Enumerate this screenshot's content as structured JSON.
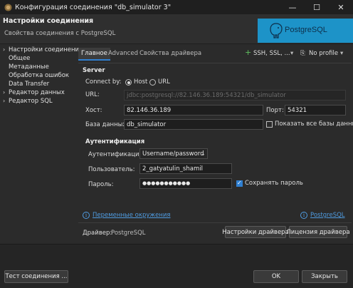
{
  "window": {
    "title": "Конфигурация соединения \"db_simulator 3\"",
    "minimize": "—",
    "maximize": "☐",
    "close": "✕"
  },
  "header": {
    "title": "Настройки соединения",
    "subtitle": "Свойства соединения с PostgreSQL",
    "logo_text": "PostgreSQL"
  },
  "sidebar": {
    "items": [
      {
        "label": "Настройки соединения",
        "expandable": true
      },
      {
        "label": "Общее",
        "expandable": false
      },
      {
        "label": "Метаданные",
        "expandable": false
      },
      {
        "label": "Обработка ошибок",
        "expandable": false
      },
      {
        "label": "Data Transfer",
        "expandable": false
      },
      {
        "label": "Редактор данных",
        "expandable": true
      },
      {
        "label": "Редактор SQL",
        "expandable": true
      }
    ]
  },
  "tabs": {
    "main": "Главное",
    "advanced": "Advanced",
    "driver_props": "Свойства драйвера",
    "ssh": "SSH, SSL, ...",
    "profile": "No profile"
  },
  "server": {
    "section": "Server",
    "connect_by_label": "Connect by:",
    "host_option": "Host",
    "url_option": "URL",
    "url_label": "URL:",
    "url_value": "jdbc:postgresql://82.146.36.189:54321/db_simulator",
    "host_label": "Хост:",
    "host_value": "82.146.36.189",
    "port_label": "Порт:",
    "port_value": "54321",
    "db_label": "База данных:",
    "db_value": "db_simulator",
    "show_all_label": "Показать все базы данных"
  },
  "auth": {
    "section": "Аутентификация",
    "auth_label": "Аутентификация:",
    "auth_value": "Username/password",
    "user_label": "Пользователь:",
    "user_value": "2_gatyatulin_shamil",
    "pass_label": "Пароль:",
    "pass_value": "●●●●●●●●●●●",
    "save_pass_label": "Сохранять пароль"
  },
  "links": {
    "env": "Переменные окружения",
    "pg": "PostgreSQL"
  },
  "driver": {
    "label": "Драйвер:",
    "value": "PostgreSQL",
    "settings_btn": "Настройки драйвера",
    "license_btn": "Лицензия драйвера"
  },
  "footer": {
    "test_btn": "Тест соединения ...",
    "ok_btn": "OK",
    "close_btn": "Закрыть"
  }
}
